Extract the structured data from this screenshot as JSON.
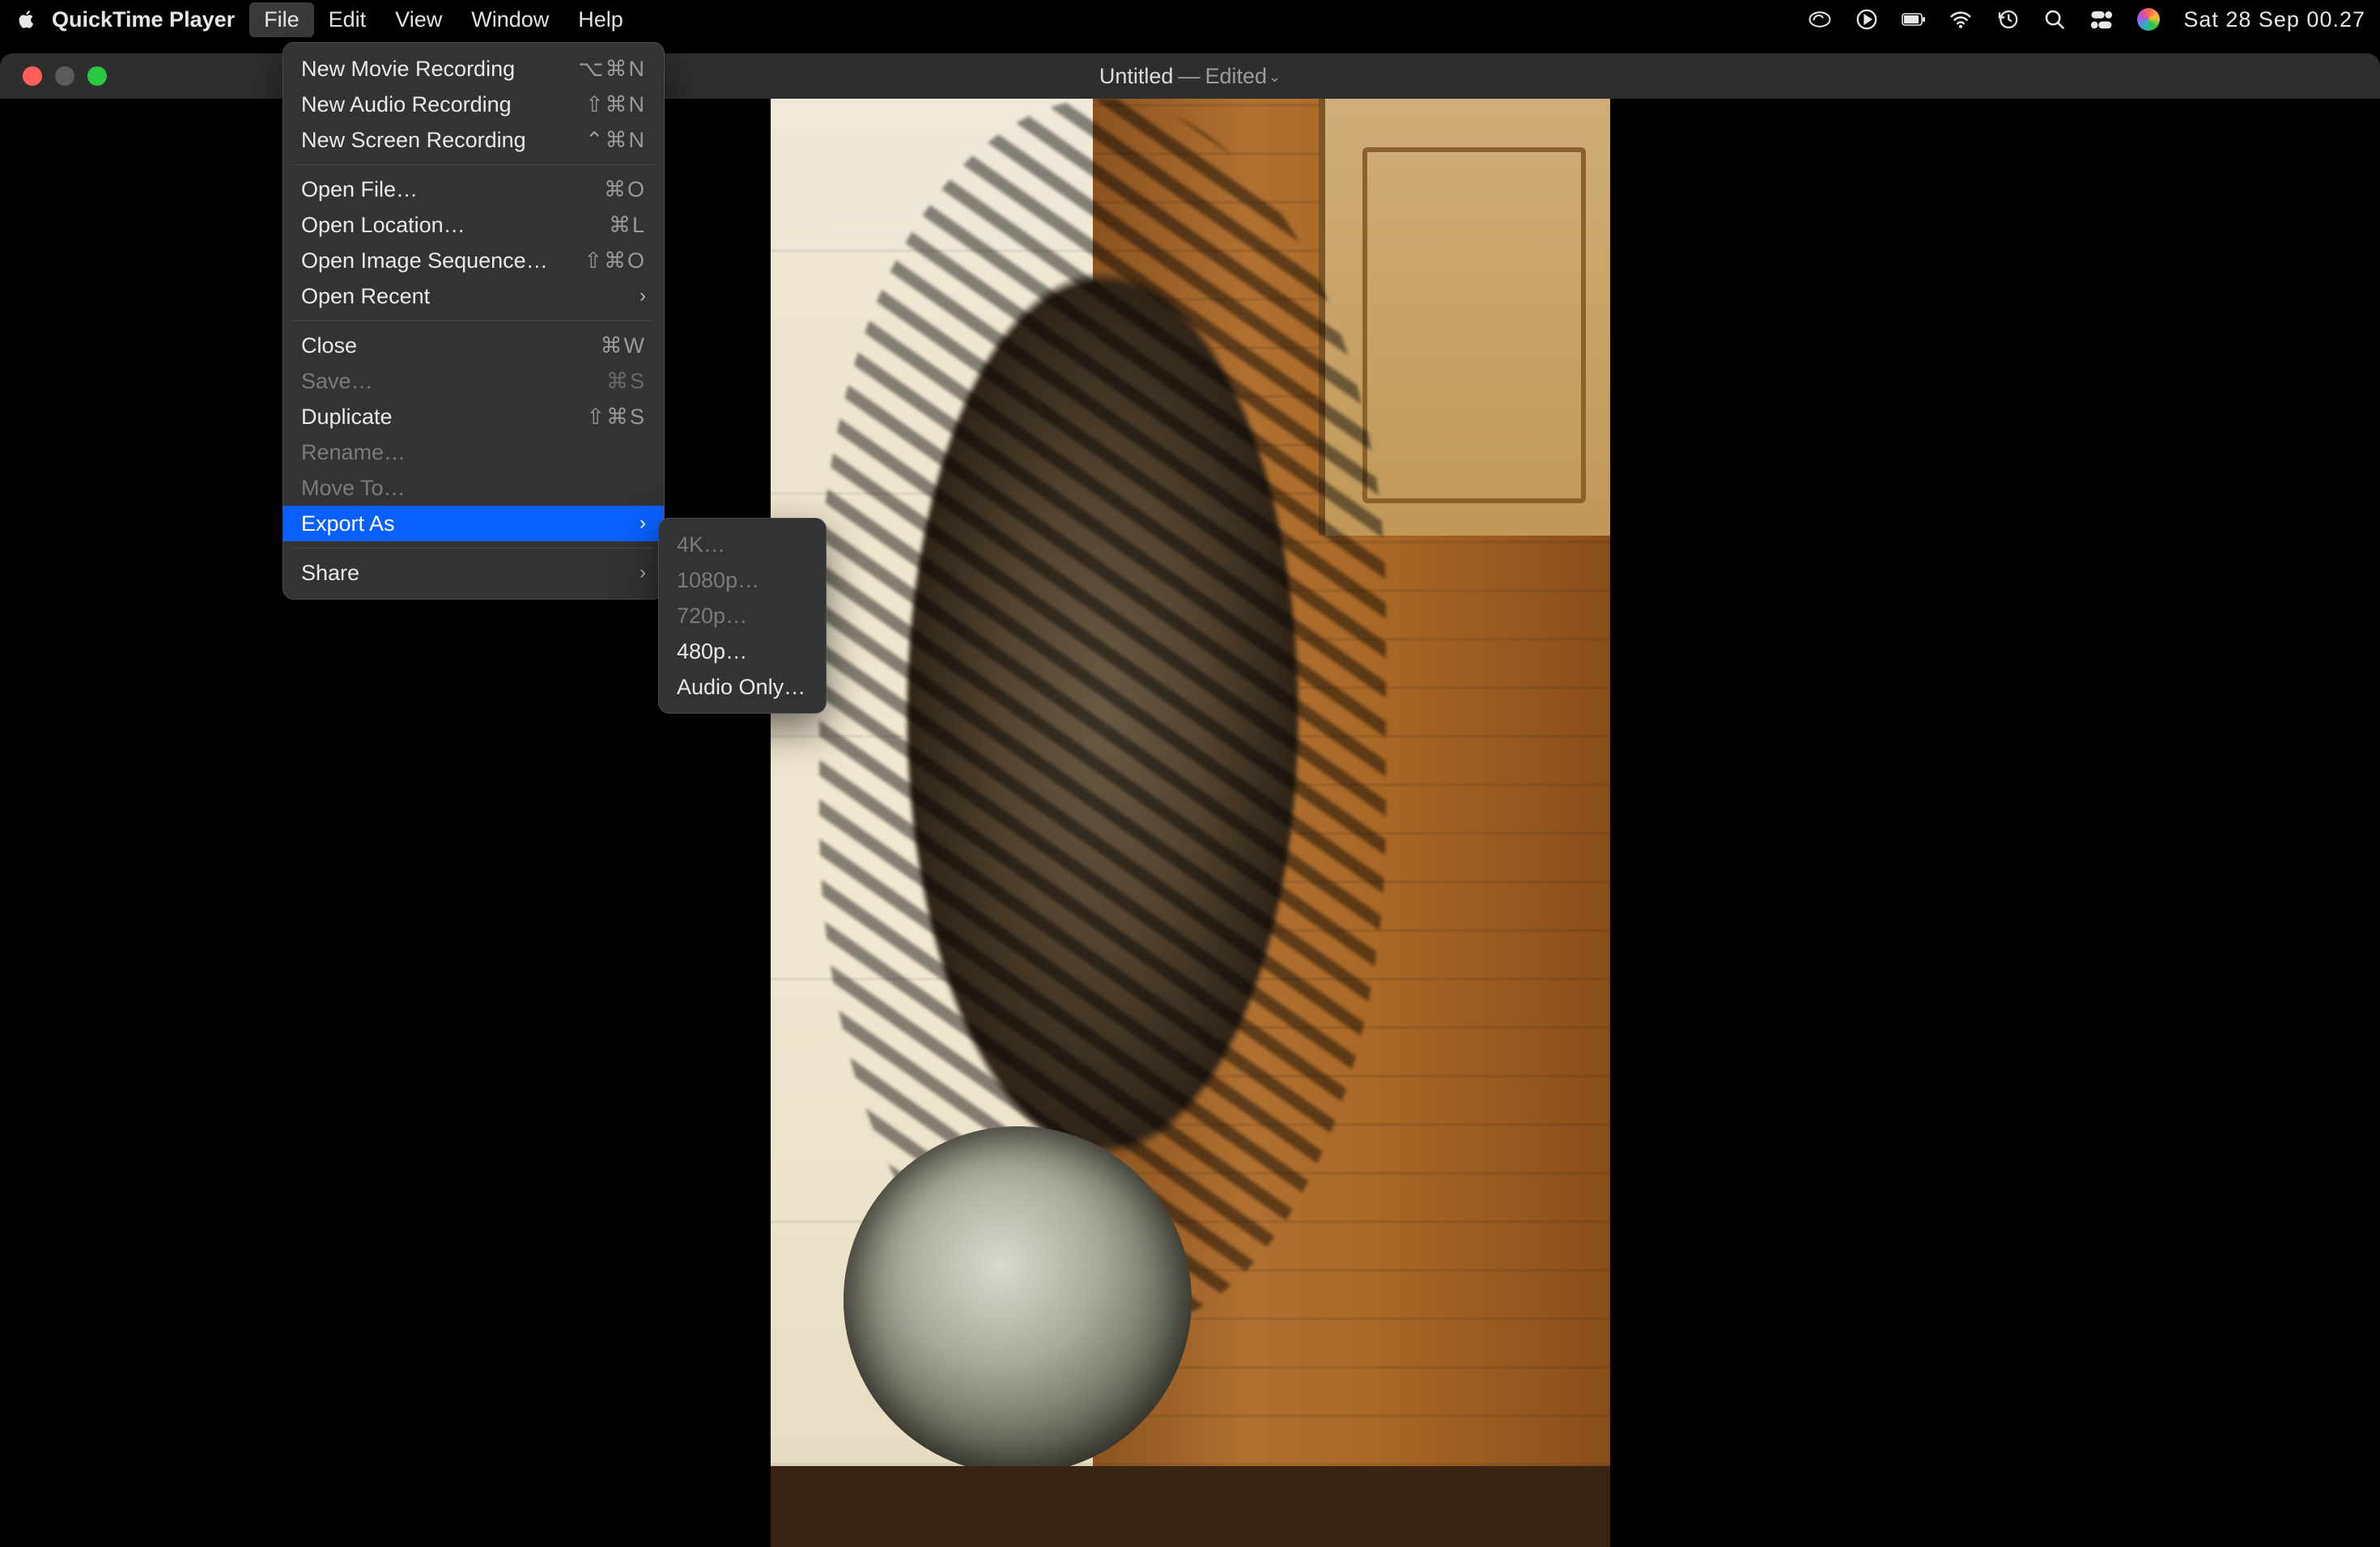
{
  "menubar": {
    "app_name": "QuickTime Player",
    "items": [
      "File",
      "Edit",
      "View",
      "Window",
      "Help"
    ],
    "open_index": 0,
    "clock": "Sat 28 Sep  00.27"
  },
  "titlebar": {
    "title": "Untitled",
    "separator": "—",
    "status": "Edited"
  },
  "file_menu": {
    "groups": [
      [
        {
          "label": "New Movie Recording",
          "shortcut": "⌥⌘N",
          "enabled": true
        },
        {
          "label": "New Audio Recording",
          "shortcut": "⇧⌘N",
          "enabled": true
        },
        {
          "label": "New Screen Recording",
          "shortcut": "⌃⌘N",
          "enabled": true
        }
      ],
      [
        {
          "label": "Open File…",
          "shortcut": "⌘O",
          "enabled": true
        },
        {
          "label": "Open Location…",
          "shortcut": "⌘L",
          "enabled": true
        },
        {
          "label": "Open Image Sequence…",
          "shortcut": "⇧⌘O",
          "enabled": true
        },
        {
          "label": "Open Recent",
          "submenu": true,
          "enabled": true
        }
      ],
      [
        {
          "label": "Close",
          "shortcut": "⌘W",
          "enabled": true
        },
        {
          "label": "Save…",
          "shortcut": "⌘S",
          "enabled": false
        },
        {
          "label": "Duplicate",
          "shortcut": "⇧⌘S",
          "enabled": true
        },
        {
          "label": "Rename…",
          "enabled": false
        },
        {
          "label": "Move To…",
          "enabled": false
        },
        {
          "label": "Export As",
          "submenu": true,
          "enabled": true,
          "highlight": true
        }
      ],
      [
        {
          "label": "Share",
          "submenu": true,
          "enabled": true
        }
      ]
    ]
  },
  "export_submenu": {
    "items": [
      {
        "label": "4K…",
        "enabled": false
      },
      {
        "label": "1080p…",
        "enabled": false
      },
      {
        "label": "720p…",
        "enabled": false
      },
      {
        "label": "480p…",
        "enabled": true
      },
      {
        "label": "Audio Only…",
        "enabled": true
      }
    ]
  },
  "menubar_icons": [
    "creative-cloud-icon",
    "screen-record-icon",
    "battery-icon",
    "wifi-icon",
    "time-machine-icon",
    "spotlight-icon",
    "control-center-icon",
    "siri-icon"
  ]
}
